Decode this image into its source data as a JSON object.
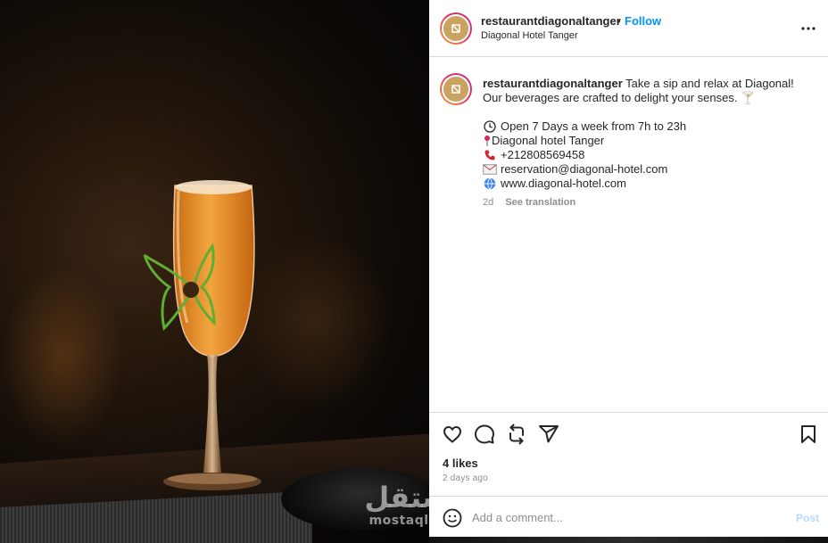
{
  "post": {
    "username": "restaurantdiagonaltanger",
    "separator": "•",
    "follow_label": "Follow",
    "location": "Diagonal Hotel Tanger",
    "more_icon": "more-horizontal-icon"
  },
  "caption": {
    "username": "restaurantdiagonaltanger",
    "text": "Take a sip and relax at Diagonal! Our beverages are crafted to delight your senses.",
    "emoji": "🍸",
    "details": [
      {
        "icon": "clock-icon",
        "text": "Open 7 Days a week from 7h to 23h"
      },
      {
        "icon": "pin-icon",
        "text": "Diagonal hotel Tanger"
      },
      {
        "icon": "phone-icon",
        "text": "+212808569458"
      },
      {
        "icon": "envelope-icon",
        "text": "reservation@diagonal-hotel.com"
      },
      {
        "icon": "globe-icon",
        "text": "www.diagonal-hotel.com"
      }
    ],
    "time": "2d",
    "see_translation": "See translation"
  },
  "actions": {
    "icons": [
      "heart-icon",
      "comment-icon",
      "repost-icon",
      "share-icon",
      "bookmark-icon"
    ],
    "likes": "4 likes",
    "ago": "2 days ago"
  },
  "comment": {
    "placeholder": "Add a comment...",
    "post_label": "Post"
  },
  "watermark": {
    "arabic": "مستقل",
    "latin": "mostaql.com"
  },
  "colors": {
    "link_blue": "#0095f6",
    "post_disabled": "#b3dbff",
    "avatar_gold": "#c9a35f",
    "text_secondary": "#8e8e8e",
    "border": "#dbdbdb"
  }
}
